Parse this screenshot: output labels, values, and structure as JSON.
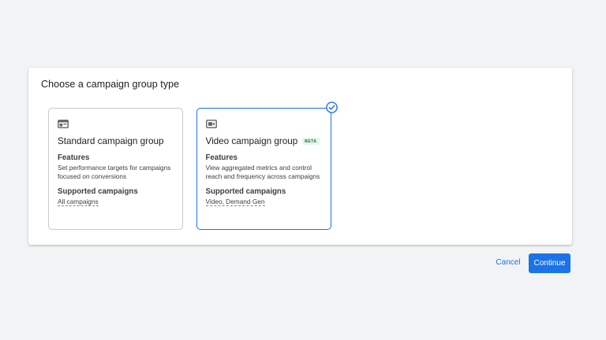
{
  "dialog": {
    "title": "Choose a campaign group type"
  },
  "cards": [
    {
      "title": "Standard campaign group",
      "icon": "campaign-window-icon",
      "features_label": "Features",
      "features_text": "Set performance targets for campaigns focused on conversions",
      "supported_label": "Supported campaigns",
      "supported_value": "All campaigns",
      "selected": false
    },
    {
      "title": "Video campaign group",
      "badge": "BETA",
      "icon": "video-camera-icon",
      "features_label": "Features",
      "features_text": "View aggregated metrics and control reach and frequency across campaigns",
      "supported_label": "Supported campaigns",
      "supported_value": "Video, Demand Gen",
      "selected": true
    }
  ],
  "actions": {
    "cancel_label": "Cancel",
    "continue_label": "Continue"
  },
  "colors": {
    "accent": "#1a73e8",
    "background": "#f1f3f4",
    "beta_badge_bg": "#e6f4ea",
    "beta_badge_text": "#137333"
  }
}
